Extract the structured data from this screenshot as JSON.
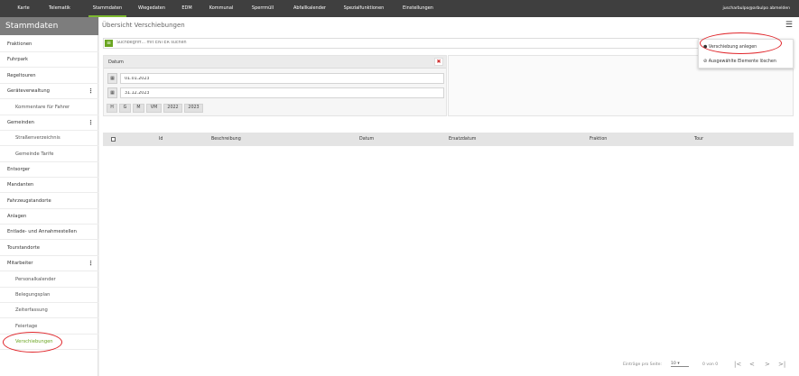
{
  "top_nav": {
    "items": [
      "Karte",
      "Telematik",
      "Stammdaten",
      "Wiegedaten",
      "EDM",
      "Kommunal",
      "Sperrmüll",
      "Abfallkalender",
      "Spezialfunktionen",
      "Einstellungen"
    ],
    "active": "Stammdaten",
    "user_text": "juscharbulpo@arbulpo abmelden"
  },
  "sidebar": {
    "title": "Stammdaten",
    "items": [
      {
        "label": "Fraktionen",
        "sub": false,
        "menu": false
      },
      {
        "label": "Fuhrpark",
        "sub": false,
        "menu": false
      },
      {
        "label": "Regeltouren",
        "sub": false,
        "menu": false
      },
      {
        "label": "Geräteverwaltung",
        "sub": false,
        "menu": true
      },
      {
        "label": "Kommentare für Fahrer",
        "sub": true,
        "menu": false
      },
      {
        "label": "Gemeinden",
        "sub": false,
        "menu": true
      },
      {
        "label": "Straßenverzeichnis",
        "sub": true,
        "menu": false
      },
      {
        "label": "Gemeinde Tarife",
        "sub": true,
        "menu": false
      },
      {
        "label": "Entsorger",
        "sub": false,
        "menu": false
      },
      {
        "label": "Mandanten",
        "sub": false,
        "menu": false
      },
      {
        "label": "Fahrzeugstandorte",
        "sub": false,
        "menu": false
      },
      {
        "label": "Anlagen",
        "sub": false,
        "menu": false
      },
      {
        "label": "Entlade- und Annahmestellen",
        "sub": false,
        "menu": false
      },
      {
        "label": "Tourstandorte",
        "sub": false,
        "menu": false
      },
      {
        "label": "Mitarbeiter",
        "sub": false,
        "menu": true
      },
      {
        "label": "Personalkalender",
        "sub": true,
        "menu": false
      },
      {
        "label": "Belegungsplan",
        "sub": true,
        "menu": false
      },
      {
        "label": "Zeiterfassung",
        "sub": true,
        "menu": false
      },
      {
        "label": "Feiertage",
        "sub": true,
        "menu": false
      },
      {
        "label": "Verschiebungen",
        "sub": true,
        "menu": false,
        "active": true
      }
    ]
  },
  "main": {
    "title": "Übersicht Verschiebungen",
    "search_placeholder": "Suchbegriff... mit ENTER suchen",
    "date_filter": {
      "header": "Datum",
      "from": "01.01.2023",
      "to": "31.12.2023",
      "quick_buttons": [
        "H",
        "G",
        "M",
        "VM",
        "2022",
        "2023"
      ]
    },
    "table": {
      "columns": [
        "Id",
        "Beschreibung",
        "Datum",
        "Ersatzdatum",
        "Fraktion",
        "Tour"
      ]
    },
    "footer": {
      "per_page_label": "Einträge pro Seite:",
      "per_page_value": "10",
      "range": "0 von 0"
    }
  },
  "action_menu": {
    "items": [
      "Verschiebung anlegen",
      "Ausgewählte Elemente löschen"
    ]
  },
  "colors": {
    "accent": "#6aa521",
    "topbar": "#3f3f3f",
    "sidebar_header": "#7d7d7d",
    "highlight_ring": "#e0252a"
  }
}
